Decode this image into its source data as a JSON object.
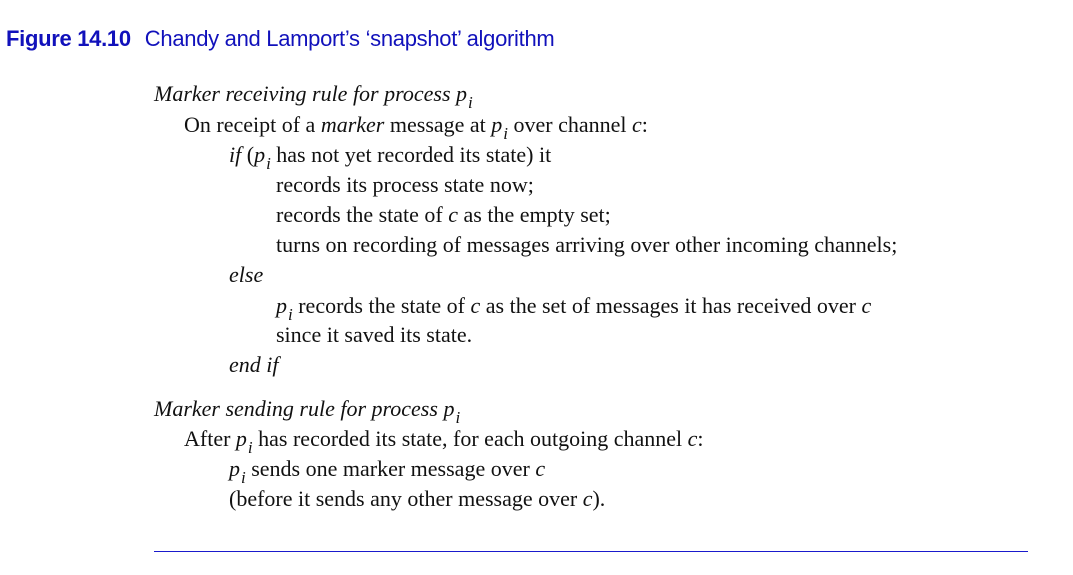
{
  "figure": {
    "label": "Figure 14.10",
    "title": "Chandy and Lamport’s ‘snapshot’ algorithm",
    "accent_color": "#1111bb"
  },
  "receiving_rule": {
    "heading": "Marker receiving rule for process",
    "heading_p": "p",
    "heading_sub": "i",
    "line1_a": "On receipt of a ",
    "line1_marker": "marker",
    "line1_b": " message at ",
    "line1_p": "p",
    "line1_sub": "i",
    "line1_c": " over channel ",
    "line1_cvar": "c",
    "line1_d": ":",
    "if_kw": "if",
    "if_open": " (",
    "if_p": "p",
    "if_sub": "i",
    "if_rest": " has not yet recorded its state) it",
    "action1": "records its process state now;",
    "action2_a": "records the state of ",
    "action2_c": "c",
    "action2_b": " as the empty set;",
    "action3": "turns on recording of messages arriving over other incoming channels;",
    "else_kw": "else",
    "else1_p": "p",
    "else1_sub": "i",
    "else1_a": " records the state of ",
    "else1_c": "c",
    "else1_b": " as the set of messages it has received over ",
    "else1_c2": "c",
    "else2": "since it saved its state.",
    "endif_kw": "end if"
  },
  "sending_rule": {
    "heading": "Marker sending rule for process",
    "heading_p": "p",
    "heading_sub": "i",
    "line1_a": "After ",
    "line1_p": "p",
    "line1_sub": "i",
    "line1_b": " has recorded its state, for each outgoing channel ",
    "line1_c": "c",
    "line1_d": ":",
    "line2_p": "p",
    "line2_sub": "i",
    "line2_a": " sends one marker message over ",
    "line2_c": "c",
    "line3_a": "(before it sends any other message over ",
    "line3_c": "c",
    "line3_b": ")."
  }
}
